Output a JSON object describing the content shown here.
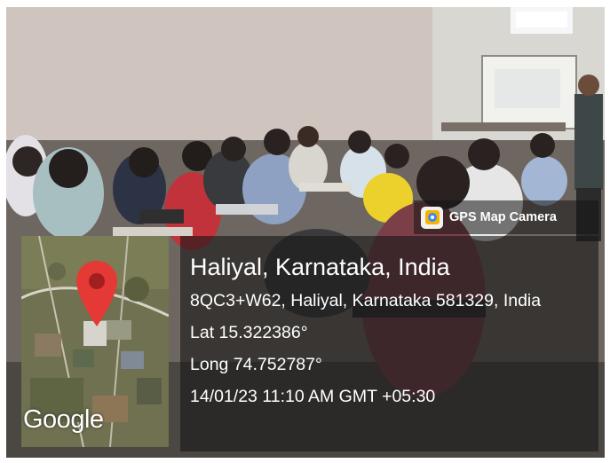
{
  "badge": {
    "app_name": "GPS Map Camera"
  },
  "map": {
    "provider_logo": "Google",
    "pin_icon": "map-pin-icon"
  },
  "location": {
    "title": "Haliyal, Karnataka, India",
    "address": "8QC3+W62, Haliyal, Karnataka 581329, India",
    "latitude": "Lat 15.322386°",
    "longitude": "Long 74.752787°",
    "datetime": "14/01/23 11:10 AM GMT +05:30"
  },
  "colors": {
    "pin": "#e53935",
    "panel": "#191919"
  }
}
